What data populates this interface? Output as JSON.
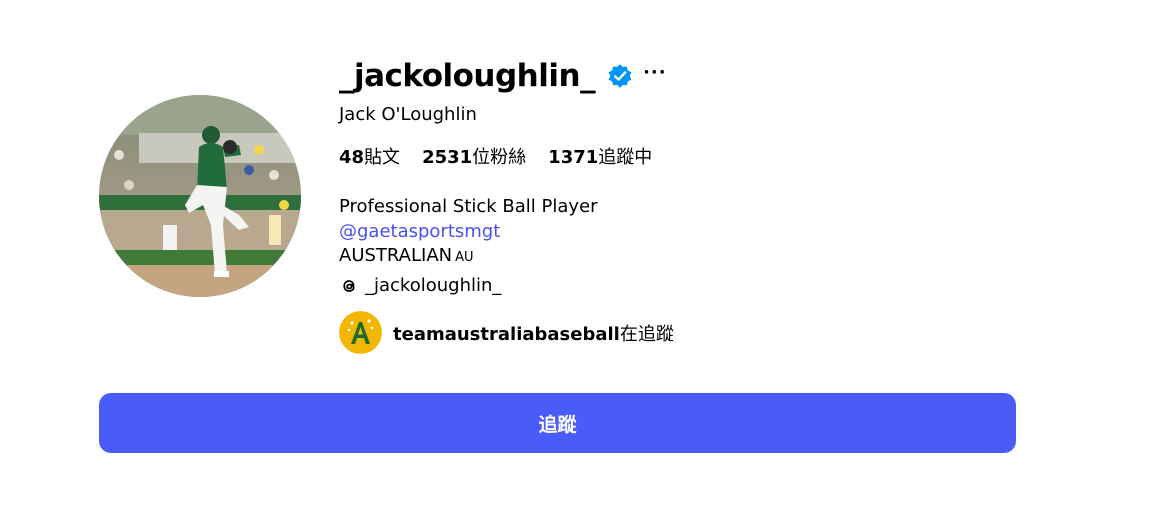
{
  "profile": {
    "username": "_jackoloughlin_",
    "full_name": "Jack O'Loughlin",
    "more_label": "···",
    "verified_icon": "verified-badge-icon",
    "avatar_icon": "profile-photo-pitcher"
  },
  "stats": {
    "posts_count": "48",
    "posts_label": "貼文",
    "followers_count": "2531",
    "followers_label": "位粉絲",
    "following_count": "1371",
    "following_label": "追蹤中"
  },
  "bio": {
    "line1": "Professional Stick Ball Player",
    "mention": "@gaetasportsmgt",
    "country": "AUSTRALIAN",
    "country_code": "AU",
    "threads_handle": "_jackoloughlin_",
    "threads_icon": "threads-icon"
  },
  "followed_by": {
    "account": "teamaustraliabaseball",
    "suffix": "在追蹤",
    "logo_icon": "team-australia-logo"
  },
  "follow_button": {
    "label": "追蹤"
  },
  "colors": {
    "accent": "#4a5cf7",
    "link": "#4a4ff0",
    "verified": "#0095f6"
  }
}
